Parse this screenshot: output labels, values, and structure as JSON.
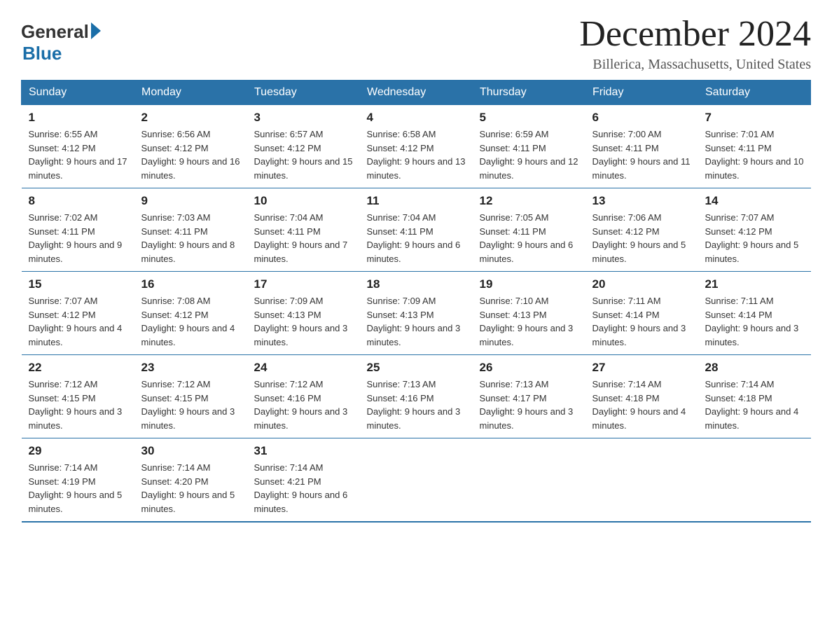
{
  "logo": {
    "general": "General",
    "blue": "Blue"
  },
  "title": "December 2024",
  "subtitle": "Billerica, Massachusetts, United States",
  "weekdays": [
    "Sunday",
    "Monday",
    "Tuesday",
    "Wednesday",
    "Thursday",
    "Friday",
    "Saturday"
  ],
  "weeks": [
    [
      {
        "day": "1",
        "sunrise": "Sunrise: 6:55 AM",
        "sunset": "Sunset: 4:12 PM",
        "daylight": "Daylight: 9 hours and 17 minutes."
      },
      {
        "day": "2",
        "sunrise": "Sunrise: 6:56 AM",
        "sunset": "Sunset: 4:12 PM",
        "daylight": "Daylight: 9 hours and 16 minutes."
      },
      {
        "day": "3",
        "sunrise": "Sunrise: 6:57 AM",
        "sunset": "Sunset: 4:12 PM",
        "daylight": "Daylight: 9 hours and 15 minutes."
      },
      {
        "day": "4",
        "sunrise": "Sunrise: 6:58 AM",
        "sunset": "Sunset: 4:12 PM",
        "daylight": "Daylight: 9 hours and 13 minutes."
      },
      {
        "day": "5",
        "sunrise": "Sunrise: 6:59 AM",
        "sunset": "Sunset: 4:11 PM",
        "daylight": "Daylight: 9 hours and 12 minutes."
      },
      {
        "day": "6",
        "sunrise": "Sunrise: 7:00 AM",
        "sunset": "Sunset: 4:11 PM",
        "daylight": "Daylight: 9 hours and 11 minutes."
      },
      {
        "day": "7",
        "sunrise": "Sunrise: 7:01 AM",
        "sunset": "Sunset: 4:11 PM",
        "daylight": "Daylight: 9 hours and 10 minutes."
      }
    ],
    [
      {
        "day": "8",
        "sunrise": "Sunrise: 7:02 AM",
        "sunset": "Sunset: 4:11 PM",
        "daylight": "Daylight: 9 hours and 9 minutes."
      },
      {
        "day": "9",
        "sunrise": "Sunrise: 7:03 AM",
        "sunset": "Sunset: 4:11 PM",
        "daylight": "Daylight: 9 hours and 8 minutes."
      },
      {
        "day": "10",
        "sunrise": "Sunrise: 7:04 AM",
        "sunset": "Sunset: 4:11 PM",
        "daylight": "Daylight: 9 hours and 7 minutes."
      },
      {
        "day": "11",
        "sunrise": "Sunrise: 7:04 AM",
        "sunset": "Sunset: 4:11 PM",
        "daylight": "Daylight: 9 hours and 6 minutes."
      },
      {
        "day": "12",
        "sunrise": "Sunrise: 7:05 AM",
        "sunset": "Sunset: 4:11 PM",
        "daylight": "Daylight: 9 hours and 6 minutes."
      },
      {
        "day": "13",
        "sunrise": "Sunrise: 7:06 AM",
        "sunset": "Sunset: 4:12 PM",
        "daylight": "Daylight: 9 hours and 5 minutes."
      },
      {
        "day": "14",
        "sunrise": "Sunrise: 7:07 AM",
        "sunset": "Sunset: 4:12 PM",
        "daylight": "Daylight: 9 hours and 5 minutes."
      }
    ],
    [
      {
        "day": "15",
        "sunrise": "Sunrise: 7:07 AM",
        "sunset": "Sunset: 4:12 PM",
        "daylight": "Daylight: 9 hours and 4 minutes."
      },
      {
        "day": "16",
        "sunrise": "Sunrise: 7:08 AM",
        "sunset": "Sunset: 4:12 PM",
        "daylight": "Daylight: 9 hours and 4 minutes."
      },
      {
        "day": "17",
        "sunrise": "Sunrise: 7:09 AM",
        "sunset": "Sunset: 4:13 PM",
        "daylight": "Daylight: 9 hours and 3 minutes."
      },
      {
        "day": "18",
        "sunrise": "Sunrise: 7:09 AM",
        "sunset": "Sunset: 4:13 PM",
        "daylight": "Daylight: 9 hours and 3 minutes."
      },
      {
        "day": "19",
        "sunrise": "Sunrise: 7:10 AM",
        "sunset": "Sunset: 4:13 PM",
        "daylight": "Daylight: 9 hours and 3 minutes."
      },
      {
        "day": "20",
        "sunrise": "Sunrise: 7:11 AM",
        "sunset": "Sunset: 4:14 PM",
        "daylight": "Daylight: 9 hours and 3 minutes."
      },
      {
        "day": "21",
        "sunrise": "Sunrise: 7:11 AM",
        "sunset": "Sunset: 4:14 PM",
        "daylight": "Daylight: 9 hours and 3 minutes."
      }
    ],
    [
      {
        "day": "22",
        "sunrise": "Sunrise: 7:12 AM",
        "sunset": "Sunset: 4:15 PM",
        "daylight": "Daylight: 9 hours and 3 minutes."
      },
      {
        "day": "23",
        "sunrise": "Sunrise: 7:12 AM",
        "sunset": "Sunset: 4:15 PM",
        "daylight": "Daylight: 9 hours and 3 minutes."
      },
      {
        "day": "24",
        "sunrise": "Sunrise: 7:12 AM",
        "sunset": "Sunset: 4:16 PM",
        "daylight": "Daylight: 9 hours and 3 minutes."
      },
      {
        "day": "25",
        "sunrise": "Sunrise: 7:13 AM",
        "sunset": "Sunset: 4:16 PM",
        "daylight": "Daylight: 9 hours and 3 minutes."
      },
      {
        "day": "26",
        "sunrise": "Sunrise: 7:13 AM",
        "sunset": "Sunset: 4:17 PM",
        "daylight": "Daylight: 9 hours and 3 minutes."
      },
      {
        "day": "27",
        "sunrise": "Sunrise: 7:14 AM",
        "sunset": "Sunset: 4:18 PM",
        "daylight": "Daylight: 9 hours and 4 minutes."
      },
      {
        "day": "28",
        "sunrise": "Sunrise: 7:14 AM",
        "sunset": "Sunset: 4:18 PM",
        "daylight": "Daylight: 9 hours and 4 minutes."
      }
    ],
    [
      {
        "day": "29",
        "sunrise": "Sunrise: 7:14 AM",
        "sunset": "Sunset: 4:19 PM",
        "daylight": "Daylight: 9 hours and 5 minutes."
      },
      {
        "day": "30",
        "sunrise": "Sunrise: 7:14 AM",
        "sunset": "Sunset: 4:20 PM",
        "daylight": "Daylight: 9 hours and 5 minutes."
      },
      {
        "day": "31",
        "sunrise": "Sunrise: 7:14 AM",
        "sunset": "Sunset: 4:21 PM",
        "daylight": "Daylight: 9 hours and 6 minutes."
      },
      null,
      null,
      null,
      null
    ]
  ]
}
